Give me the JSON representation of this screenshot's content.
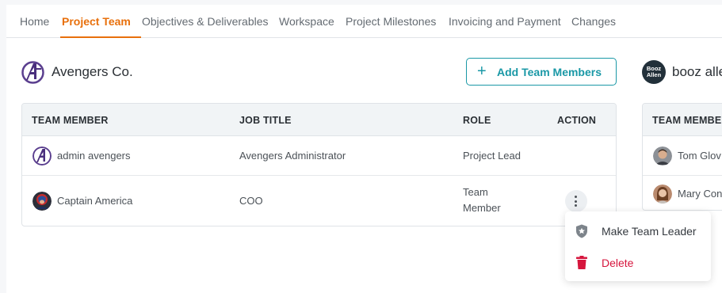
{
  "tabs": [
    {
      "label": "Home"
    },
    {
      "label": "Project Team",
      "active": true
    },
    {
      "label": "Objectives & Deliverables"
    },
    {
      "label": "Workspace"
    },
    {
      "label": "Project Milestones"
    },
    {
      "label": "Invoicing and Payment"
    },
    {
      "label": "Changes"
    }
  ],
  "left_company": {
    "name": "Avengers Co.",
    "logo_icon": "avengers-logo-icon",
    "add_button": {
      "label": "Add Team Members",
      "icon": "plus-icon"
    },
    "columns": [
      "TEAM MEMBER",
      "JOB TITLE",
      "ROLE",
      "ACTION"
    ],
    "rows": [
      {
        "name": "admin avengers",
        "job_title": "Avengers Administrator",
        "role": "Project Lead",
        "avatar_icon": "avengers-avatar-icon"
      },
      {
        "name": "Captain America",
        "job_title": "COO",
        "role": "Team Member",
        "avatar_icon": "captain-america-avatar-icon"
      }
    ]
  },
  "right_company": {
    "name": "booz alle",
    "logo_text_line1": "Booz",
    "logo_text_line2": "Allen",
    "columns": [
      "TEAM MEMBER"
    ],
    "rows": [
      {
        "name": "Tom Glov"
      },
      {
        "name": "Mary Con"
      }
    ]
  },
  "action_menu": {
    "items": [
      {
        "label": "Make Team Leader",
        "icon": "shield-star-icon",
        "color": "#34393f"
      },
      {
        "label": "Delete",
        "icon": "trash-icon",
        "color": "#d6163d"
      }
    ]
  },
  "colors": {
    "accent": "#e8700c",
    "teal": "#1a98a6",
    "danger": "#d6163d"
  }
}
